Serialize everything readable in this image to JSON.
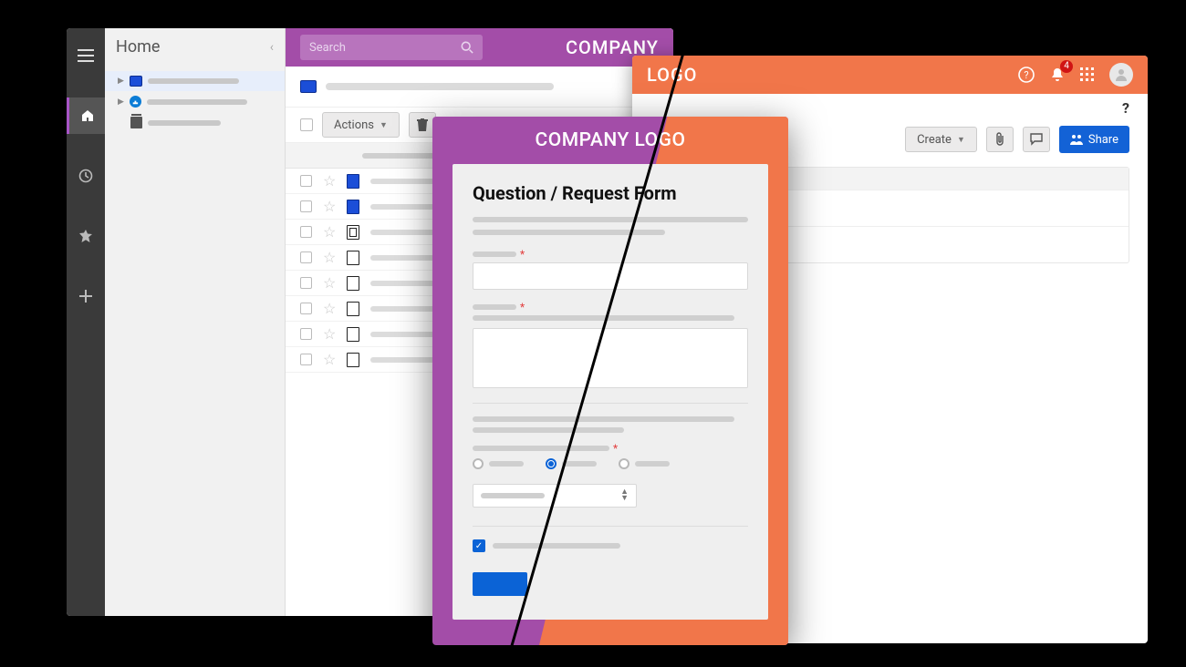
{
  "left_app": {
    "home_label": "Home",
    "search_placeholder": "Search",
    "brand": "COMPANY",
    "actions_button": "Actions",
    "file_rows": 8
  },
  "right_app": {
    "brand": "LOGO",
    "notification_count": "4",
    "help_label": "?",
    "create_button": "Create",
    "share_button": "Share"
  },
  "modal": {
    "brand": "COMPANY LOGO",
    "title": "Question / Request Form"
  }
}
